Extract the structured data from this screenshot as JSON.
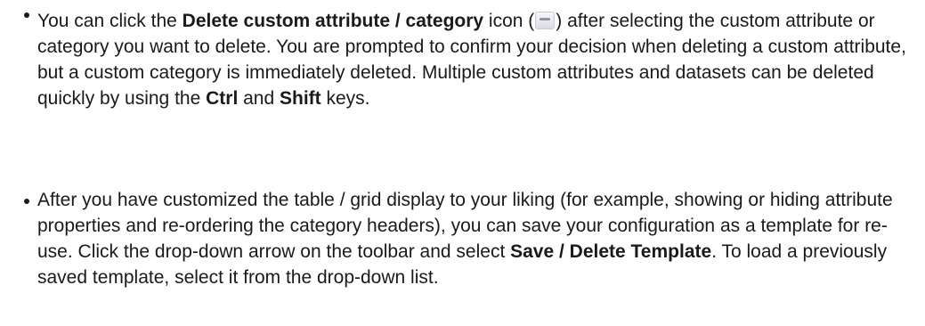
{
  "bullet1": {
    "t1": "You can click the ",
    "b1": "Delete custom attribute / category",
    "t2": " icon (",
    "icon": "delete-custom-attribute-icon",
    "t3": ") after selecting the custom attribute or category you want to delete. You are prompted to confirm your decision when deleting a custom attribute, but a custom category is immediately deleted. Multiple custom attributes and datasets can be deleted quickly by using the ",
    "b2": "Ctrl",
    "t4": " and ",
    "b3": "Shift",
    "t5": " keys."
  },
  "bullet2": {
    "t1": "After you have customized the table / grid display to your liking (for example, showing or hiding attribute properties and re-ordering the category headers), you can save your configuration as a template for re-use. Click the drop-down arrow on the toolbar and select ",
    "b1": "Save / Delete Template",
    "t2": ". To load a previously saved template, select it from the drop-down list."
  }
}
